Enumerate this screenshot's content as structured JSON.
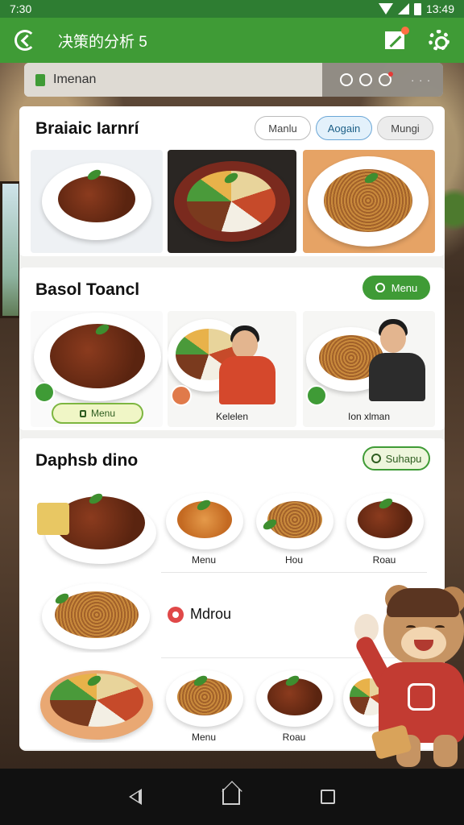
{
  "status": {
    "time": "7:30",
    "battery_text": "13:49"
  },
  "appbar": {
    "title": "决策的分析 5"
  },
  "search": {
    "value": "Imenan"
  },
  "section1": {
    "title": "Braiaic Iarnrí",
    "chips": [
      "Manlu",
      "Aogain",
      "Mungi"
    ]
  },
  "section2": {
    "title": "Basol Toancl",
    "menu_pill": "Menu",
    "tiles": [
      {
        "caption": "",
        "button": "Menu"
      },
      {
        "caption": "Kelelen"
      },
      {
        "caption": "Ion xlman"
      }
    ]
  },
  "section3": {
    "title": "Daphsb dino",
    "pill": "Suhapu",
    "row1_captions": [
      "Menu",
      "Hou",
      "Roau"
    ],
    "menu_row_label": "Mdrou",
    "row3_captions": [
      "Menu",
      "Roau"
    ]
  },
  "colors": {
    "brand_green": "#3f9b36",
    "status_green": "#2e7d32",
    "accent_red": "#c23b32"
  }
}
